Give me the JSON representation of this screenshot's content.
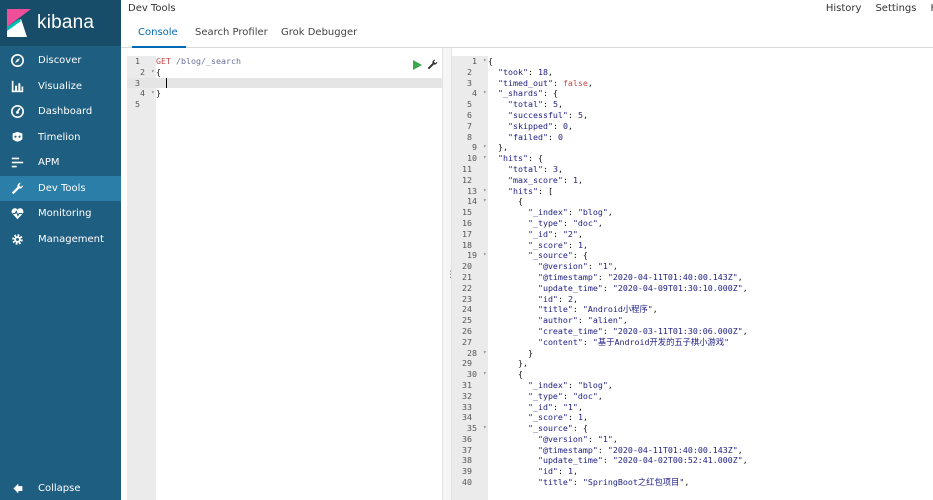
{
  "brand": {
    "name": "kibana"
  },
  "header": {
    "title": "Dev Tools",
    "links": [
      "History",
      "Settings",
      "H"
    ]
  },
  "tabs": [
    {
      "label": "Console",
      "active": true
    },
    {
      "label": "Search Profiler",
      "active": false
    },
    {
      "label": "Grok Debugger",
      "active": false
    }
  ],
  "sidebar": {
    "items": [
      {
        "label": "Discover",
        "icon": "compass-icon",
        "active": false
      },
      {
        "label": "Visualize",
        "icon": "bar-chart-icon",
        "active": false
      },
      {
        "label": "Dashboard",
        "icon": "dashboard-icon",
        "active": false
      },
      {
        "label": "Timelion",
        "icon": "timelion-icon",
        "active": false
      },
      {
        "label": "APM",
        "icon": "apm-icon",
        "active": false
      },
      {
        "label": "Dev Tools",
        "icon": "wrench-icon",
        "active": true
      },
      {
        "label": "Monitoring",
        "icon": "heartbeat-icon",
        "active": false
      },
      {
        "label": "Management",
        "icon": "gear-icon",
        "active": false
      }
    ],
    "collapse_label": "Collapse"
  },
  "request": {
    "lines": [
      [
        [
          "c-method",
          "GET"
        ],
        [
          "c-punc",
          " "
        ],
        [
          "c-path",
          "/blog/_search"
        ]
      ],
      [
        [
          "c-punc",
          "{"
        ]
      ],
      [
        [
          "c-punc",
          "  "
        ]
      ],
      [
        [
          "c-punc",
          "}"
        ]
      ],
      [
        [
          "c-punc",
          ""
        ]
      ]
    ],
    "fold_lines": [
      2,
      4
    ],
    "highlight_line": 3
  },
  "response": {
    "fold_lines": [
      1,
      4,
      9,
      10,
      13,
      14,
      19,
      28,
      30,
      35
    ],
    "lines": [
      [
        [
          "c-punc",
          "{"
        ]
      ],
      [
        [
          "c-key",
          "  \"took\""
        ],
        [
          "c-punc",
          ": "
        ],
        [
          "c-num",
          "18"
        ],
        [
          "c-punc",
          ","
        ]
      ],
      [
        [
          "c-key",
          "  \"timed_out\""
        ],
        [
          "c-punc",
          ": "
        ],
        [
          "c-bool",
          "false"
        ],
        [
          "c-punc",
          ","
        ]
      ],
      [
        [
          "c-key",
          "  \"_shards\""
        ],
        [
          "c-punc",
          ": {"
        ]
      ],
      [
        [
          "c-key",
          "    \"total\""
        ],
        [
          "c-punc",
          ": "
        ],
        [
          "c-num",
          "5"
        ],
        [
          "c-punc",
          ","
        ]
      ],
      [
        [
          "c-key",
          "    \"successful\""
        ],
        [
          "c-punc",
          ": "
        ],
        [
          "c-num",
          "5"
        ],
        [
          "c-punc",
          ","
        ]
      ],
      [
        [
          "c-key",
          "    \"skipped\""
        ],
        [
          "c-punc",
          ": "
        ],
        [
          "c-num",
          "0"
        ],
        [
          "c-punc",
          ","
        ]
      ],
      [
        [
          "c-key",
          "    \"failed\""
        ],
        [
          "c-punc",
          ": "
        ],
        [
          "c-num",
          "0"
        ]
      ],
      [
        [
          "c-punc",
          "  },"
        ]
      ],
      [
        [
          "c-key",
          "  \"hits\""
        ],
        [
          "c-punc",
          ": {"
        ]
      ],
      [
        [
          "c-key",
          "    \"total\""
        ],
        [
          "c-punc",
          ": "
        ],
        [
          "c-num",
          "3"
        ],
        [
          "c-punc",
          ","
        ]
      ],
      [
        [
          "c-key",
          "    \"max_score\""
        ],
        [
          "c-punc",
          ": "
        ],
        [
          "c-num",
          "1"
        ],
        [
          "c-punc",
          ","
        ]
      ],
      [
        [
          "c-key",
          "    \"hits\""
        ],
        [
          "c-punc",
          ": ["
        ]
      ],
      [
        [
          "c-punc",
          "      {"
        ]
      ],
      [
        [
          "c-key",
          "        \"_index\""
        ],
        [
          "c-punc",
          ": "
        ],
        [
          "c-str",
          "\"blog\""
        ],
        [
          "c-punc",
          ","
        ]
      ],
      [
        [
          "c-key",
          "        \"_type\""
        ],
        [
          "c-punc",
          ": "
        ],
        [
          "c-str",
          "\"doc\""
        ],
        [
          "c-punc",
          ","
        ]
      ],
      [
        [
          "c-key",
          "        \"_id\""
        ],
        [
          "c-punc",
          ": "
        ],
        [
          "c-str",
          "\"2\""
        ],
        [
          "c-punc",
          ","
        ]
      ],
      [
        [
          "c-key",
          "        \"_score\""
        ],
        [
          "c-punc",
          ": "
        ],
        [
          "c-num",
          "1"
        ],
        [
          "c-punc",
          ","
        ]
      ],
      [
        [
          "c-key",
          "        \"_source\""
        ],
        [
          "c-punc",
          ": {"
        ]
      ],
      [
        [
          "c-key",
          "          \"@version\""
        ],
        [
          "c-punc",
          ": "
        ],
        [
          "c-str",
          "\"1\""
        ],
        [
          "c-punc",
          ","
        ]
      ],
      [
        [
          "c-key",
          "          \"@timestamp\""
        ],
        [
          "c-punc",
          ": "
        ],
        [
          "c-str",
          "\"2020-04-11T01:40:00.143Z\""
        ],
        [
          "c-punc",
          ","
        ]
      ],
      [
        [
          "c-key",
          "          \"update_time\""
        ],
        [
          "c-punc",
          ": "
        ],
        [
          "c-str",
          "\"2020-04-09T01:30:10.000Z\""
        ],
        [
          "c-punc",
          ","
        ]
      ],
      [
        [
          "c-key",
          "          \"id\""
        ],
        [
          "c-punc",
          ": "
        ],
        [
          "c-num",
          "2"
        ],
        [
          "c-punc",
          ","
        ]
      ],
      [
        [
          "c-key",
          "          \"title\""
        ],
        [
          "c-punc",
          ": "
        ],
        [
          "c-str",
          "\"Android小程序\""
        ],
        [
          "c-punc",
          ","
        ]
      ],
      [
        [
          "c-key",
          "          \"author\""
        ],
        [
          "c-punc",
          ": "
        ],
        [
          "c-str",
          "\"alien\""
        ],
        [
          "c-punc",
          ","
        ]
      ],
      [
        [
          "c-key",
          "          \"create_time\""
        ],
        [
          "c-punc",
          ": "
        ],
        [
          "c-str",
          "\"2020-03-11T01:30:06.000Z\""
        ],
        [
          "c-punc",
          ","
        ]
      ],
      [
        [
          "c-key",
          "          \"content\""
        ],
        [
          "c-punc",
          ": "
        ],
        [
          "c-str",
          "\"基于Android开发的五子棋小游戏\""
        ]
      ],
      [
        [
          "c-punc",
          "        }"
        ]
      ],
      [
        [
          "c-punc",
          "      },"
        ]
      ],
      [
        [
          "c-punc",
          "      {"
        ]
      ],
      [
        [
          "c-key",
          "        \"_index\""
        ],
        [
          "c-punc",
          ": "
        ],
        [
          "c-str",
          "\"blog\""
        ],
        [
          "c-punc",
          ","
        ]
      ],
      [
        [
          "c-key",
          "        \"_type\""
        ],
        [
          "c-punc",
          ": "
        ],
        [
          "c-str",
          "\"doc\""
        ],
        [
          "c-punc",
          ","
        ]
      ],
      [
        [
          "c-key",
          "        \"_id\""
        ],
        [
          "c-punc",
          ": "
        ],
        [
          "c-str",
          "\"1\""
        ],
        [
          "c-punc",
          ","
        ]
      ],
      [
        [
          "c-key",
          "        \"_score\""
        ],
        [
          "c-punc",
          ": "
        ],
        [
          "c-num",
          "1"
        ],
        [
          "c-punc",
          ","
        ]
      ],
      [
        [
          "c-key",
          "        \"_source\""
        ],
        [
          "c-punc",
          ": {"
        ]
      ],
      [
        [
          "c-key",
          "          \"@version\""
        ],
        [
          "c-punc",
          ": "
        ],
        [
          "c-str",
          "\"1\""
        ],
        [
          "c-punc",
          ","
        ]
      ],
      [
        [
          "c-key",
          "          \"@timestamp\""
        ],
        [
          "c-punc",
          ": "
        ],
        [
          "c-str",
          "\"2020-04-11T01:40:00.143Z\""
        ],
        [
          "c-punc",
          ","
        ]
      ],
      [
        [
          "c-key",
          "          \"update_time\""
        ],
        [
          "c-punc",
          ": "
        ],
        [
          "c-str",
          "\"2020-04-02T00:52:41.000Z\""
        ],
        [
          "c-punc",
          ","
        ]
      ],
      [
        [
          "c-key",
          "          \"id\""
        ],
        [
          "c-punc",
          ": "
        ],
        [
          "c-num",
          "1"
        ],
        [
          "c-punc",
          ","
        ]
      ],
      [
        [
          "c-key",
          "          \"title\""
        ],
        [
          "c-punc",
          ": "
        ],
        [
          "c-str",
          "\"SpringBoot之红包项目\""
        ],
        [
          "c-punc",
          ","
        ]
      ]
    ]
  },
  "colors": {
    "sidebar_bg": "#1e5e80",
    "sidebar_active": "#2b7ea7",
    "accent": "#006bb4",
    "play": "#3caa4c"
  }
}
